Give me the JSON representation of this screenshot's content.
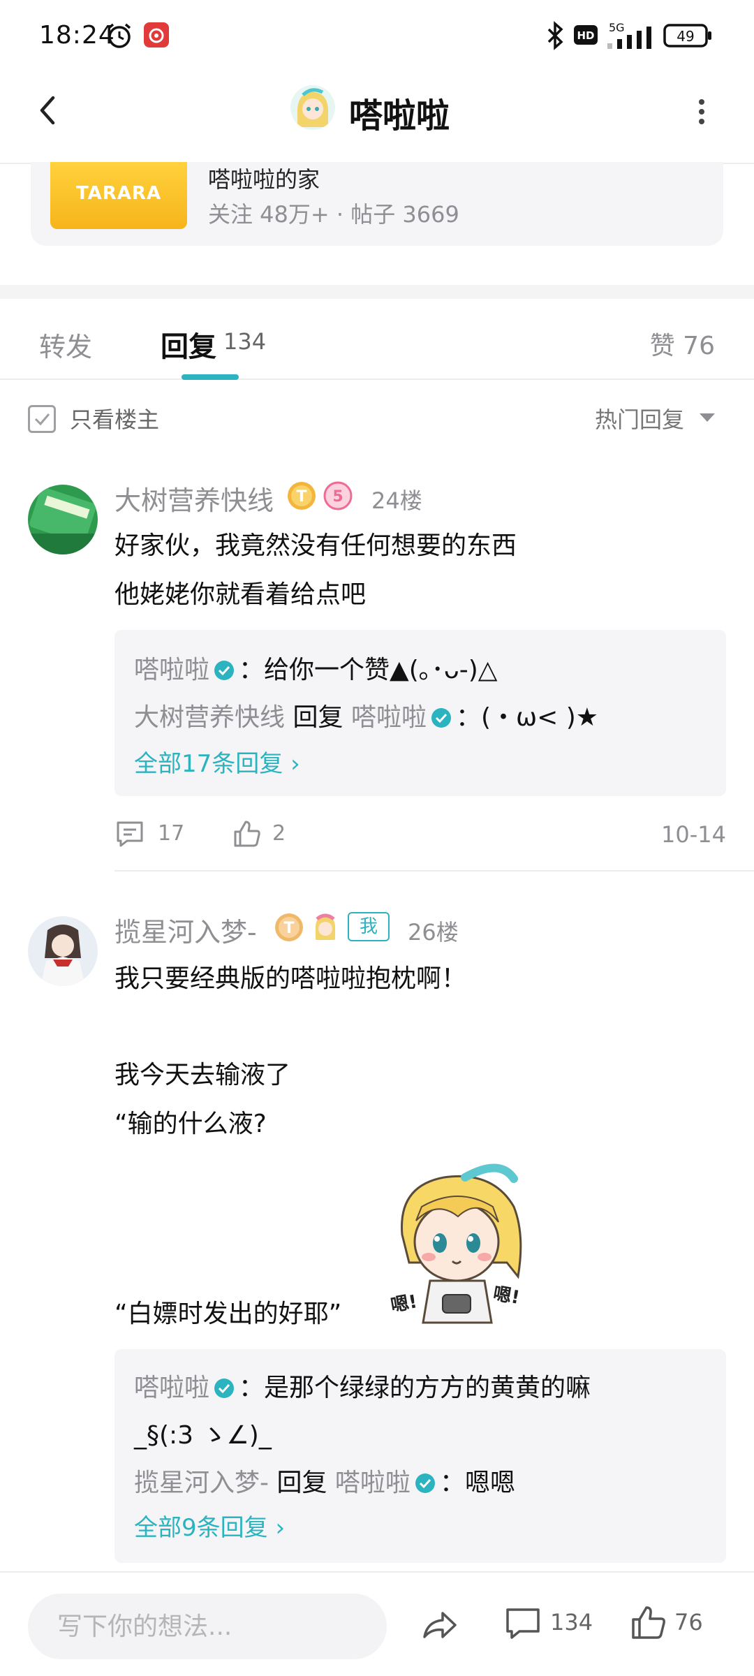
{
  "status_bar": {
    "time": "18:24",
    "network": "5G",
    "hd": "HD",
    "battery": "49",
    "icons": [
      "alarm-icon",
      "netease-music-icon",
      "bluetooth-icon",
      "hd-icon",
      "signal-icon",
      "battery-icon"
    ]
  },
  "nav": {
    "title": "嗒啦啦",
    "icons": [
      "back-icon",
      "more-icon"
    ]
  },
  "forum": {
    "logo_text": "TARARA",
    "name": "嗒啦啦的家",
    "stats": "关注 48万+  ·  帖子 3669"
  },
  "tabs": {
    "repost": "转发",
    "reply": "回复",
    "reply_count": "134",
    "like": "赞 76"
  },
  "filter": {
    "only_author": "只看楼主",
    "sort": "热门回复"
  },
  "posts": [
    {
      "user": "大树营养快线",
      "floor": "24楼",
      "lines": [
        "好家伙，我竟然没有任何想要的东西",
        "他姥姥你就看着给点吧"
      ],
      "sub_replies": [
        {
          "user": "嗒啦啦",
          "text": "：给你一个赞▲(｡･ᴗ-)△"
        },
        {
          "user": "大树营养快线",
          "reply_word": "回复",
          "target": "嗒啦啦",
          "text": "：(・ω< )★"
        }
      ],
      "all_replies": "全部17条回复 ›",
      "comment_count": "17",
      "like_count": "2",
      "date": "10-14"
    },
    {
      "user": "揽星河入梦-",
      "me": "我",
      "floor": "26楼",
      "lines": [
        "我只要经典版的嗒啦啦抱枕啊！",
        "我今天去输液了",
        "“输的什么液?",
        "“白嫖时发出的好耶”"
      ],
      "sticker_text": "嗯！嗯！",
      "sub_replies": [
        {
          "user": "嗒啦啦",
          "text": "：是那个绿绿的方方的黄黄的嘛",
          "text2": "_§(:3 ゝ∠)_"
        },
        {
          "user": "揽星河入梦-",
          "reply_word": "回复",
          "target": "嗒啦啦",
          "text": "：嗯嗯"
        }
      ],
      "all_replies": "全部9条回复 ›"
    }
  ],
  "bottom_bar": {
    "placeholder": "写下你的想法...",
    "comment_count": "134",
    "like_count": "76"
  },
  "colors": {
    "accent": "#2bb3c0",
    "logo_yellow": "#f7b41a",
    "muted": "#8e8e93"
  }
}
